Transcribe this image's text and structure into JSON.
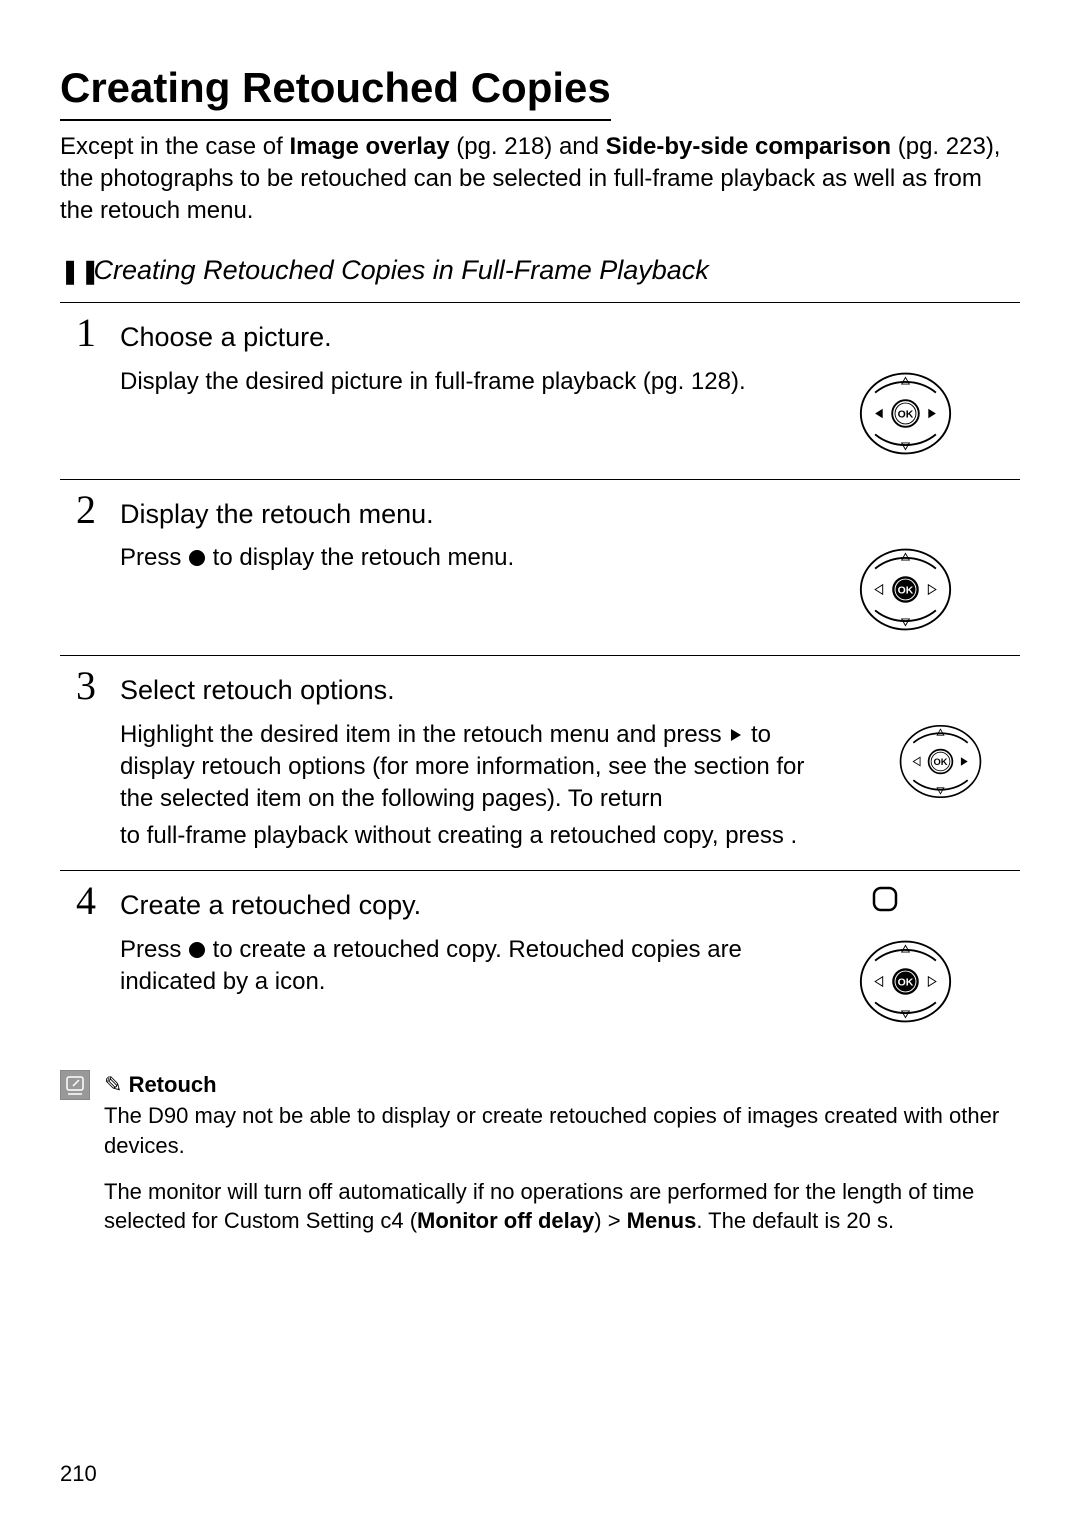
{
  "title": "Creating Retouched Copies",
  "intro": {
    "pre": "Except in the case of ",
    "b1": "Image overlay",
    "mid1": " (pg. 218) and ",
    "b2": "Side-by-side comparison",
    "mid2": " (pg. 223), the photographs to be retouched can be selected in full-frame playback as well as from the retouch menu."
  },
  "sub_symbol": "❚❚",
  "sub_heading": "Creating Retouched Copies in Full-Frame Playback",
  "steps": [
    {
      "num": "1",
      "title": "Choose a picture.",
      "text": "Display the desired picture in full-frame playback (pg. 128).",
      "dial": {
        "up": false,
        "down": false,
        "left": true,
        "right": true,
        "ok": false
      }
    },
    {
      "num": "2",
      "title": "Display the retouch menu.",
      "text_pre": "Press ",
      "text_post": " to display the retouch menu.",
      "dial": {
        "up": false,
        "down": false,
        "left": false,
        "right": false,
        "ok": true
      }
    },
    {
      "num": "3",
      "title": "Select retouch options.",
      "text_pre": "Highlight the desired item in the retouch menu and press ",
      "text_post": " to display retouch options (for more information, see the section for the selected item on the following pages).  To return",
      "long": "to full-frame playback without creating a retouched copy, press      .",
      "dial": {
        "up": false,
        "down": false,
        "left": false,
        "right": true,
        "ok": false
      }
    },
    {
      "num": "4",
      "title": "Create a retouched copy.",
      "text_pre": "Press ",
      "text_post": " to create a retouched copy.  Retouched copies are indicated by a       icon.",
      "dial": {
        "up": false,
        "down": false,
        "left": false,
        "right": false,
        "ok": true
      }
    }
  ],
  "note": {
    "title": "Retouch",
    "para1": "The D90 may not be able to display or create retouched copies of images created with other devices.",
    "para2_pre": "The monitor will turn off automatically if no operations are performed for the length of time selected for Custom Setting c4 (",
    "para2_b1": "Monitor off delay",
    "para2_mid": ") > ",
    "para2_b2": "Menus",
    "para2_post": ".  The default is 20 s."
  },
  "page_number": "210",
  "ok_label": "OK"
}
